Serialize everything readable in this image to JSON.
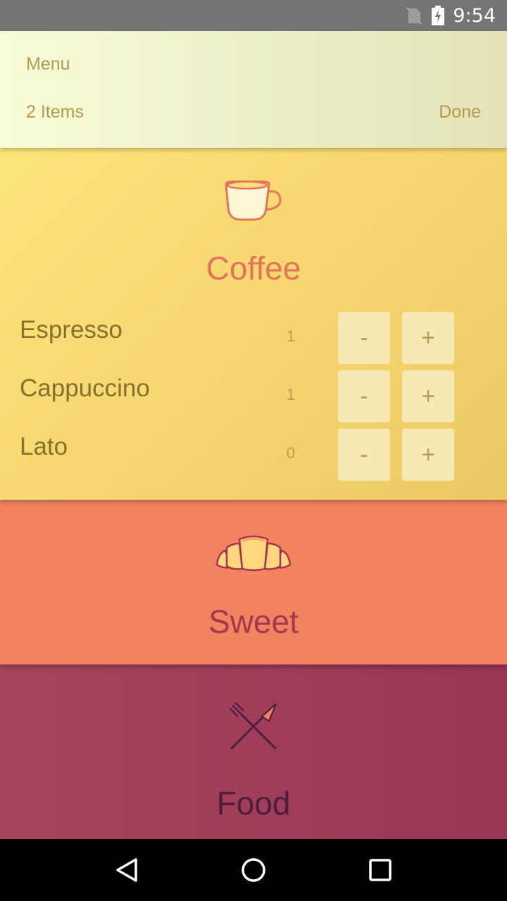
{
  "status_bar": {
    "time": "9:54"
  },
  "header": {
    "title": "Menu",
    "item_count": "2 Items",
    "done_label": "Done"
  },
  "sections": [
    {
      "title": "Coffee",
      "icon": "coffee-cup-icon",
      "items": [
        {
          "name": "Espresso",
          "qty": "1",
          "minus": "-",
          "plus": "+"
        },
        {
          "name": "Cappuccino",
          "qty": "1",
          "minus": "-",
          "plus": "+"
        },
        {
          "name": "Lato",
          "qty": "0",
          "minus": "-",
          "plus": "+"
        }
      ]
    },
    {
      "title": "Sweet",
      "icon": "croissant-icon"
    },
    {
      "title": "Food",
      "icon": "fork-knife-icon"
    }
  ],
  "colors": {
    "coffee_bg": "#f7d66f",
    "coffee_title": "#e5735b",
    "sweet_bg": "#f2835f",
    "sweet_title": "#a5364f",
    "food_bg": "#a13c58",
    "food_title": "#4a1e3f",
    "item_text": "#86702e",
    "accent_text": "#b49a4c"
  }
}
